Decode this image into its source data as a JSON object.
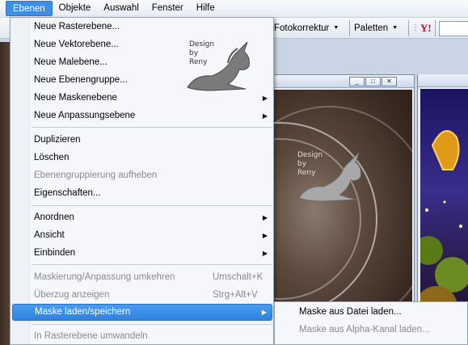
{
  "menubar": {
    "items": [
      "Ebenen",
      "Objekte",
      "Auswahl",
      "Fenster",
      "Hilfe"
    ],
    "active": "Ebenen"
  },
  "toolbar": {
    "fotokorrektur": "Fotokorrektur",
    "paletten": "Paletten",
    "yahoo": "Y!"
  },
  "menu": {
    "items": [
      {
        "label": "Neue Rasterebene...",
        "disabled": false,
        "submenu": false
      },
      {
        "label": "Neue Vektorebene...",
        "disabled": false,
        "submenu": false
      },
      {
        "label": "Neue Malebene...",
        "disabled": false,
        "submenu": false
      },
      {
        "label": "Neue Ebenengruppe...",
        "disabled": false,
        "submenu": false
      },
      {
        "label": "Neue Maskenebene",
        "disabled": false,
        "submenu": true
      },
      {
        "label": "Neue Anpassungsebene",
        "disabled": false,
        "submenu": true
      },
      {
        "label": "Duplizieren",
        "disabled": false,
        "submenu": false
      },
      {
        "label": "Löschen",
        "disabled": false,
        "submenu": false
      },
      {
        "label": "Ebenengruppierung aufheben",
        "disabled": true,
        "submenu": false
      },
      {
        "label": "Eigenschaften...",
        "disabled": false,
        "submenu": false
      },
      {
        "label": "Anordnen",
        "disabled": false,
        "submenu": true
      },
      {
        "label": "Ansicht",
        "disabled": false,
        "submenu": true
      },
      {
        "label": "Einbinden",
        "disabled": false,
        "submenu": true
      },
      {
        "label": "Maskierung/Anpassung umkehren",
        "disabled": true,
        "submenu": false,
        "shortcut": "Umschalt+K"
      },
      {
        "label": "Überzug anzeigen",
        "disabled": true,
        "submenu": false,
        "shortcut": "Strg+Alt+V"
      },
      {
        "label": "Maske laden/speichern",
        "disabled": false,
        "submenu": true,
        "highlighted": true
      },
      {
        "label": "In Rasterebene umwandeln",
        "disabled": true,
        "submenu": false
      }
    ]
  },
  "submenu": {
    "items": [
      {
        "label": "Maske aus Datei laden...",
        "disabled": false
      },
      {
        "label": "Maske aus Alpha-Kanal laden...",
        "disabled": true
      }
    ]
  },
  "watermark": {
    "lines": [
      "Design",
      "by",
      "Reny"
    ]
  },
  "colors": {
    "highlight": "#3f8ee6",
    "menu_bg": "#f5f7fa",
    "disabled_text": "#8a8a8a"
  }
}
